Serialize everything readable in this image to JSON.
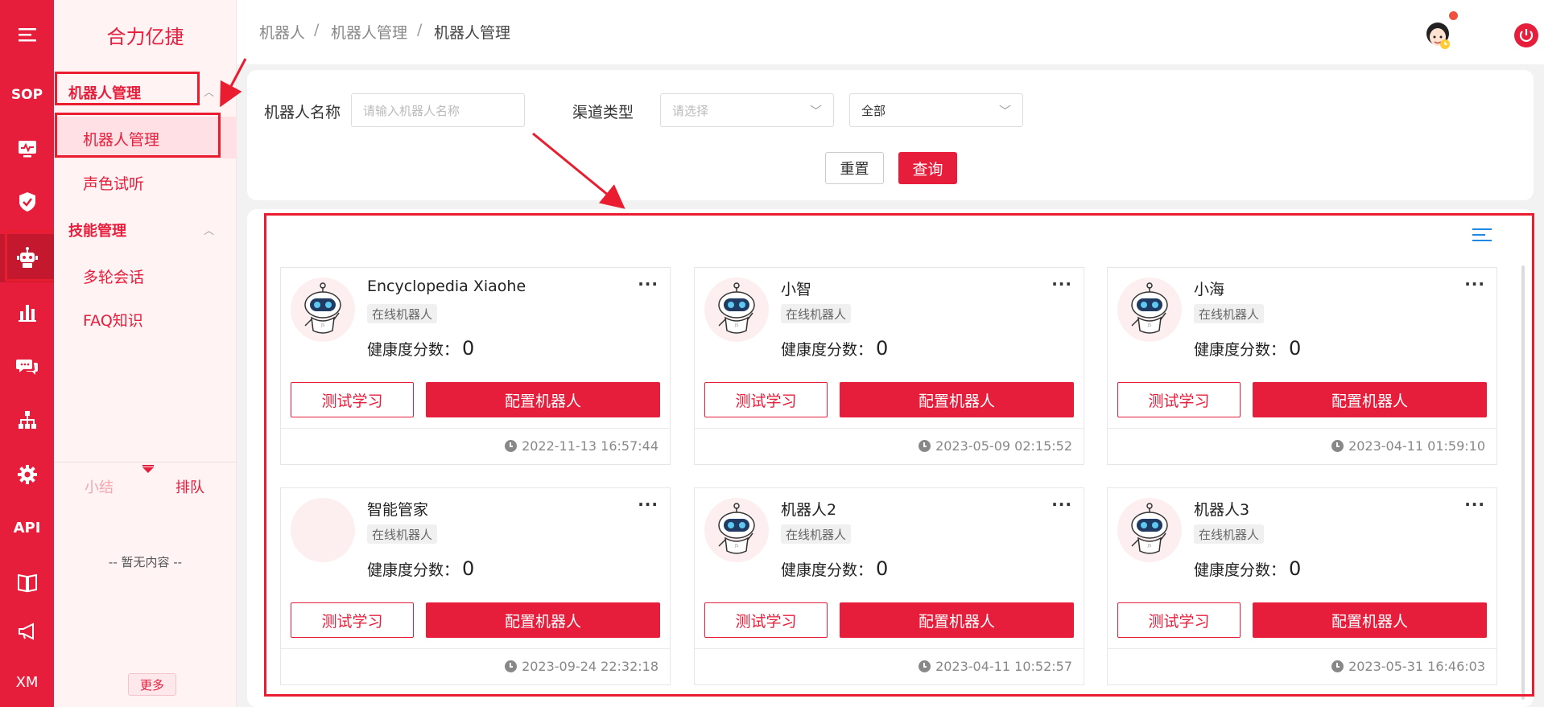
{
  "app": {
    "brand": "合力亿捷"
  },
  "rail": {
    "items": [
      {
        "icon": "hamburger-icon"
      },
      {
        "label": "SOP"
      },
      {
        "icon": "monitor-icon"
      },
      {
        "icon": "shield-icon"
      },
      {
        "icon": "robot-icon"
      },
      {
        "icon": "bar-chart-icon"
      },
      {
        "icon": "chat-icon"
      },
      {
        "icon": "org-tree-icon"
      },
      {
        "icon": "gear-icon"
      },
      {
        "label": "API"
      },
      {
        "icon": "book-icon"
      },
      {
        "icon": "megaphone-icon"
      },
      {
        "label": "XM"
      }
    ]
  },
  "submenu": {
    "group1": "机器人管理",
    "group1_items": [
      "机器人管理",
      "声色试听"
    ],
    "group2": "技能管理",
    "group2_items": [
      "多轮会话",
      "FAQ知识"
    ],
    "tab_left": "小结",
    "tab_right": "排队",
    "empty": "-- 暂无内容 --",
    "more": "更多"
  },
  "breadcrumb": [
    "机器人",
    "机器人管理",
    "机器人管理"
  ],
  "breadcrumb_sep": "/",
  "filter": {
    "name_label": "机器人名称",
    "name_placeholder": "请输入机器人名称",
    "channel_label": "渠道类型",
    "channel_placeholder": "请选择",
    "scope_value": "全部",
    "reset": "重置",
    "query": "查询"
  },
  "cards": [
    {
      "name": "Encyclopedia Xiaohe",
      "tag": "在线机器人",
      "health_label": "健康度分数：",
      "health": "0",
      "test": "测试学习",
      "config": "配置机器人",
      "time": "2022-11-13 16:57:44",
      "avatar": true
    },
    {
      "name": "小智",
      "tag": "在线机器人",
      "health_label": "健康度分数：",
      "health": "0",
      "test": "测试学习",
      "config": "配置机器人",
      "time": "2023-05-09 02:15:52",
      "avatar": true
    },
    {
      "name": "小海",
      "tag": "在线机器人",
      "health_label": "健康度分数：",
      "health": "0",
      "test": "测试学习",
      "config": "配置机器人",
      "time": "2023-04-11 01:59:10",
      "avatar": true
    },
    {
      "name": "智能管家",
      "tag": "在线机器人",
      "health_label": "健康度分数：",
      "health": "0",
      "test": "测试学习",
      "config": "配置机器人",
      "time": "2023-09-24 22:32:18",
      "avatar": false
    },
    {
      "name": "机器人2",
      "tag": "在线机器人",
      "health_label": "健康度分数：",
      "health": "0",
      "test": "测试学习",
      "config": "配置机器人",
      "time": "2023-04-11 10:52:57",
      "avatar": true
    },
    {
      "name": "机器人3",
      "tag": "在线机器人",
      "health_label": "健康度分数：",
      "health": "0",
      "test": "测试学习",
      "config": "配置机器人",
      "time": "2023-05-31 16:46:03",
      "avatar": true
    }
  ],
  "colors": {
    "primary": "#e61e3b",
    "submenu_bg": "#fff3f4",
    "link": "#1e88e5"
  }
}
